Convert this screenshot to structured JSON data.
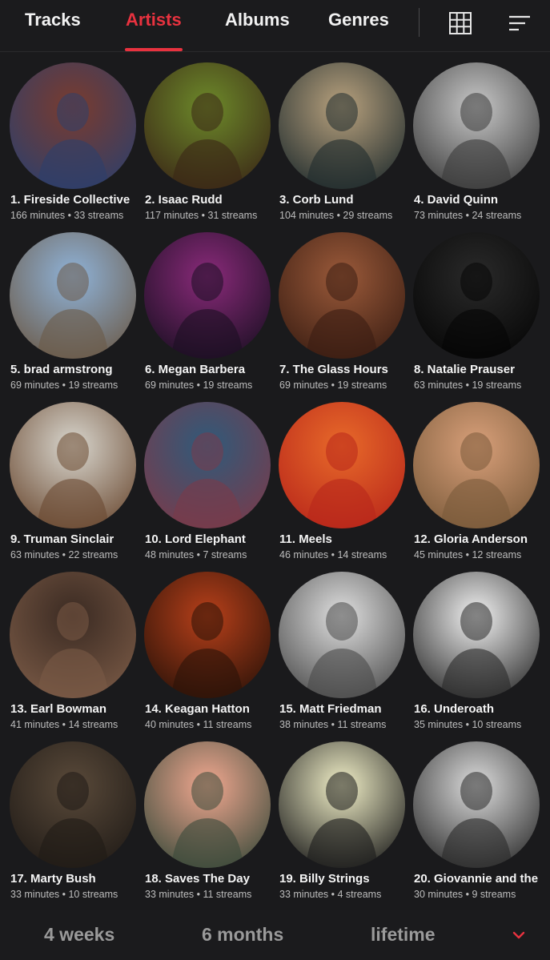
{
  "tabs": [
    {
      "label": "Tracks",
      "active": false
    },
    {
      "label": "Artists",
      "active": true
    },
    {
      "label": "Albums",
      "active": false
    },
    {
      "label": "Genres",
      "active": false
    }
  ],
  "icons": {
    "grid": "grid-view-icon",
    "sort": "sort-icon",
    "expand": "chevron-down-icon"
  },
  "colors": {
    "accent": "#e8323f",
    "background": "#1a1a1c"
  },
  "artists": [
    {
      "name": "1. Fireside Collective",
      "stats": "166 minutes • 33 streams",
      "tone": [
        "#7a3b2e",
        "#2d3f6b"
      ]
    },
    {
      "name": "2. Isaac Rudd",
      "stats": "117 minutes • 31 streams",
      "tone": [
        "#6d8a2a",
        "#3a2616"
      ]
    },
    {
      "name": "3. Corb Lund",
      "stats": "104 minutes • 29 streams",
      "tone": [
        "#b9a27e",
        "#1f2b2d"
      ]
    },
    {
      "name": "4. David Quinn",
      "stats": "73 minutes • 24 streams",
      "tone": [
        "#c8c8c8",
        "#3a3a3a"
      ]
    },
    {
      "name": "5. brad armstrong",
      "stats": "69 minutes • 19 streams",
      "tone": [
        "#8fb3d9",
        "#6b5a48"
      ]
    },
    {
      "name": "6. Megan Barbera",
      "stats": "69 minutes • 19 streams",
      "tone": [
        "#8a2a7a",
        "#1a0f22"
      ]
    },
    {
      "name": "7. The Glass Hours",
      "stats": "69 minutes • 19 streams",
      "tone": [
        "#9b5a3a",
        "#3a1d12"
      ]
    },
    {
      "name": "8. Natalie Prauser",
      "stats": "63 minutes • 19 streams",
      "tone": [
        "#2a2a2a",
        "#050505"
      ]
    },
    {
      "name": "9. Truman Sinclair",
      "stats": "63 minutes • 22 streams",
      "tone": [
        "#d9d7cf",
        "#6b4a32"
      ]
    },
    {
      "name": "10. Lord Elephant",
      "stats": "48 minutes • 7 streams",
      "tone": [
        "#2f5a7a",
        "#7a3a4a"
      ]
    },
    {
      "name": "11. Meels",
      "stats": "46 minutes • 14 streams",
      "tone": [
        "#e86a2a",
        "#b8261a"
      ]
    },
    {
      "name": "12. Gloria Anderson",
      "stats": "45 minutes • 12 streams",
      "tone": [
        "#d9a07a",
        "#7a5a3a"
      ]
    },
    {
      "name": "13. Earl Bowman",
      "stats": "41 minutes • 14 streams",
      "tone": [
        "#3a2a22",
        "#7a5a46"
      ]
    },
    {
      "name": "14. Keagan Hatton",
      "stats": "40 minutes • 11 streams",
      "tone": [
        "#b8401a",
        "#2a1208"
      ]
    },
    {
      "name": "15. Matt Friedman",
      "stats": "38 minutes • 11 streams",
      "tone": [
        "#e0e0e0",
        "#4a4a4a"
      ]
    },
    {
      "name": "16. Underoath",
      "stats": "35 minutes • 10 streams",
      "tone": [
        "#f2f2f2",
        "#2a2a2a"
      ]
    },
    {
      "name": "17. Marty Bush",
      "stats": "33 minutes • 10 streams",
      "tone": [
        "#5a4a3a",
        "#1f1a16"
      ]
    },
    {
      "name": "18. Saves The Day",
      "stats": "33 minutes • 11 streams",
      "tone": [
        "#f2a890",
        "#3a4a3a"
      ]
    },
    {
      "name": "19. Billy Strings",
      "stats": "33 minutes • 4 streams",
      "tone": [
        "#f2f0c8",
        "#1a1a1a"
      ]
    },
    {
      "name": "20. Giovannie and the",
      "stats": "30 minutes • 9 streams",
      "tone": [
        "#dcdcdc",
        "#2a2a2a"
      ]
    }
  ],
  "periods": [
    {
      "label": "4 weeks"
    },
    {
      "label": "6 months"
    },
    {
      "label": "lifetime"
    }
  ]
}
